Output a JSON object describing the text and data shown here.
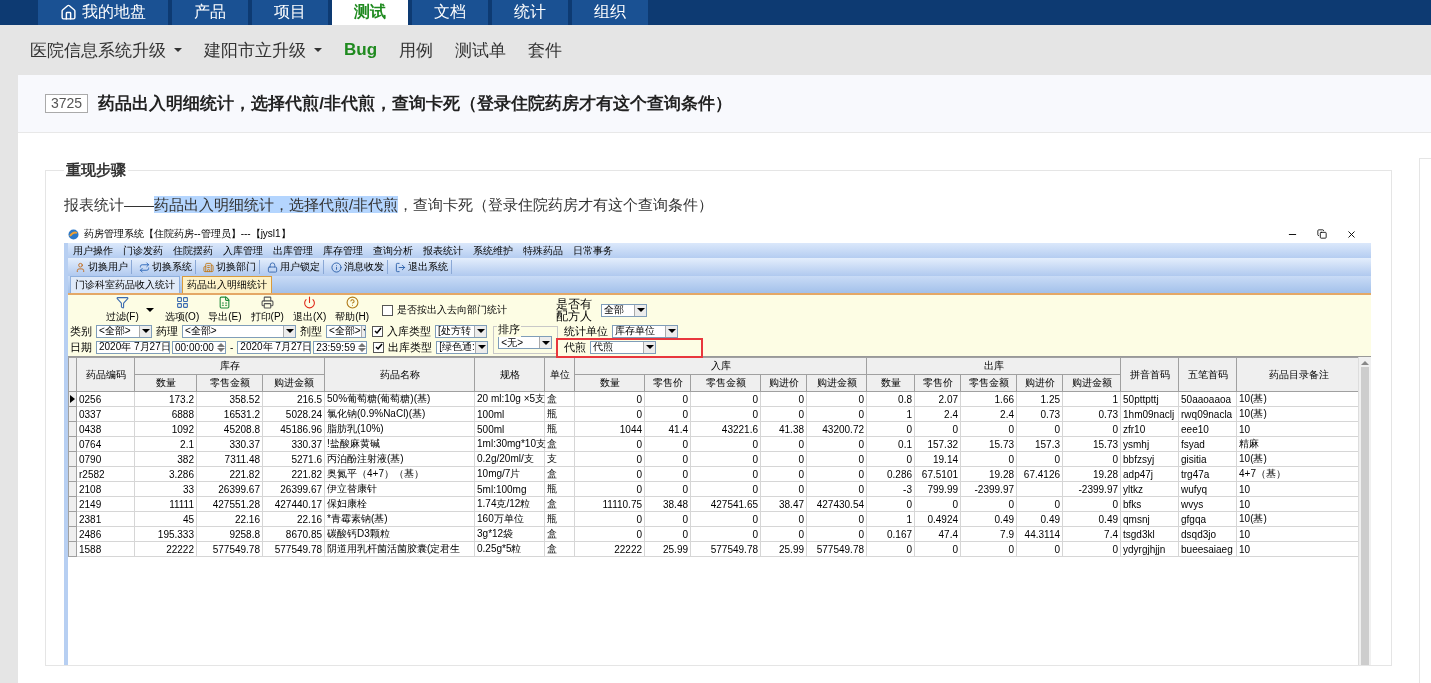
{
  "top_nav": {
    "tabs": [
      {
        "label": "我的地盘",
        "kind": "home",
        "selected": false
      },
      {
        "label": "产品",
        "kind": "plain",
        "selected": false
      },
      {
        "label": "项目",
        "kind": "plain",
        "selected": false
      },
      {
        "label": "测试",
        "kind": "plain",
        "selected": true
      },
      {
        "label": "文档",
        "kind": "plain",
        "selected": false
      },
      {
        "label": "统计",
        "kind": "plain",
        "selected": false
      },
      {
        "label": "组织",
        "kind": "plain",
        "selected": false
      }
    ]
  },
  "sub_nav": {
    "items": [
      {
        "label": "医院信息系统升级",
        "dropdown": true,
        "selected": false
      },
      {
        "label": "建阳市立升级",
        "dropdown": true,
        "selected": false
      },
      {
        "label": "Bug",
        "dropdown": false,
        "selected": true
      },
      {
        "label": "用例",
        "dropdown": false,
        "selected": false
      },
      {
        "label": "测试单",
        "dropdown": false,
        "selected": false
      },
      {
        "label": "套件",
        "dropdown": false,
        "selected": false
      }
    ]
  },
  "bug": {
    "id": "3725",
    "title": "药品出入明细统计，选择代煎/非代煎，查询卡死（登录住院药房才有这个查询条件）"
  },
  "section": {
    "legend": "重现步骤",
    "paragraph": [
      {
        "text": "报表统计——",
        "highlighted": false
      },
      {
        "text": "药品出入明细统计，选择代煎/非代煎",
        "highlighted": true
      },
      {
        "text": "，查询卡死（登录住院药房才有这个查询条件）",
        "highlighted": false
      }
    ]
  },
  "app_window": {
    "title": "药房管理系统【住院药房--管理员】---【jysl1】",
    "menu": [
      "用户操作",
      "门诊发药",
      "住院摆药",
      "入库管理",
      "出库管理",
      "库存管理",
      "查询分析",
      "报表统计",
      "系统维护",
      "特殊药品",
      "日常事务"
    ],
    "toolbar": [
      {
        "label": "切换用户",
        "kind": "user"
      },
      {
        "label": "切换系统",
        "kind": "system"
      },
      {
        "label": "切换部门",
        "kind": "department"
      },
      {
        "label": "用户锁定",
        "kind": "lock"
      },
      {
        "label": "消息收发",
        "kind": "message"
      },
      {
        "label": "退出系统",
        "kind": "exit"
      }
    ],
    "tabs": [
      {
        "label": "门诊科室药品收入统计",
        "selected": false
      },
      {
        "label": "药品出入明细统计",
        "selected": true
      }
    ],
    "filter": {
      "actions": [
        {
          "label": "过滤(F)",
          "kind": "filter",
          "dropdown": true
        },
        {
          "label": "选项(O)",
          "kind": "options",
          "dropdown": false
        },
        {
          "label": "导出(E)",
          "kind": "export",
          "dropdown": false
        },
        {
          "label": "打印(P)",
          "kind": "print",
          "dropdown": false
        },
        {
          "label": "退出(X)",
          "kind": "exit",
          "dropdown": false
        },
        {
          "label": "帮助(H)",
          "kind": "help",
          "dropdown": false
        }
      ],
      "dept_option": {
        "label": "是否按出入去向部门统计",
        "checked": false
      },
      "prescriber": {
        "label": "是否有配方人",
        "value": "全部"
      },
      "category": {
        "label": "类别",
        "value": "<全部>"
      },
      "pharmacology": {
        "label": "药理",
        "value": "<全部>"
      },
      "dosage_form": {
        "label": "剂型",
        "value": "<全部>"
      },
      "date": {
        "label": "日期",
        "from_date": "2020年 7月27日",
        "from_time": "00:00:00",
        "separator": "-",
        "to_date": "2020年 7月27日",
        "to_time": "23:59:59"
      },
      "in_type": {
        "label": "入库类型",
        "checked": true,
        "value": "[处方转"
      },
      "out_type": {
        "label": "出库类型",
        "checked": true,
        "value": "[绿色通:"
      },
      "sort": {
        "label": "排序",
        "value": "<无>"
      },
      "unit": {
        "label": "统计单位",
        "value": "库存单位"
      },
      "decoction": {
        "label": "代煎",
        "value": "代煎"
      }
    },
    "table": {
      "header": [
        {
          "label": "药品编码"
        },
        {
          "label": "库存",
          "sub": [
            "数量",
            "零售金额",
            "购进金额"
          ]
        },
        {
          "label": "药品名称"
        },
        {
          "label": "规格"
        },
        {
          "label": "单位"
        },
        {
          "label": "入库",
          "sub": [
            "数量",
            "零售价",
            "零售金额",
            "购进价",
            "购进金额"
          ]
        },
        {
          "label": "出库",
          "sub": [
            "数量",
            "零售价",
            "零售金额",
            "购进价",
            "购进金额"
          ]
        },
        {
          "label": "拼音首码"
        },
        {
          "label": "五笔首码"
        },
        {
          "label": "药品目录备注"
        }
      ],
      "rows": [
        {
          "selected": true,
          "cells": [
            "0256",
            "173.2",
            "358.52",
            "216.5",
            "50%葡萄糖(葡萄糖)(基)",
            "20 ml:10g ×5支",
            "盒",
            "0",
            "0",
            "0",
            "0",
            "0",
            "0.8",
            "2.07",
            "1.66",
            "1.25",
            "1",
            "50pttpttj",
            "50aaoaaoa",
            "10(基)"
          ]
        },
        {
          "selected": false,
          "cells": [
            "0337",
            "6888",
            "16531.2",
            "5028.24",
            "氯化钠(0.9%NaCl)(基)",
            "100ml",
            "瓶",
            "0",
            "0",
            "0",
            "0",
            "0",
            "1",
            "2.4",
            "2.4",
            "0.73",
            "0.73",
            "1hm09naclj",
            "rwq09nacla",
            "10(基)"
          ]
        },
        {
          "selected": false,
          "cells": [
            "0438",
            "1092",
            "45208.8",
            "45186.96",
            "脂肪乳(10%)",
            "500ml",
            "瓶",
            "1044",
            "41.4",
            "43221.6",
            "41.38",
            "43200.72",
            "0",
            "0",
            "0",
            "0",
            "0",
            "zfr10",
            "eee10",
            "10"
          ]
        },
        {
          "selected": false,
          "cells": [
            "0764",
            "2.1",
            "330.37",
            "330.37",
            "!盐酸麻黄碱",
            "1ml:30mg*10支",
            "盒",
            "0",
            "0",
            "0",
            "0",
            "0",
            "0.1",
            "157.32",
            "15.73",
            "157.3",
            "15.73",
            "ysmhj",
            "fsyad",
            "精麻"
          ]
        },
        {
          "selected": false,
          "cells": [
            "0790",
            "382",
            "7311.48",
            "5271.6",
            "丙泊酚注射液(基)",
            "0.2g/20ml/支",
            "支",
            "0",
            "0",
            "0",
            "0",
            "0",
            "0",
            "19.14",
            "0",
            "0",
            "0",
            "bbfzsyj",
            "gisitia",
            "10(基)"
          ]
        },
        {
          "selected": false,
          "cells": [
            "r2582",
            "3.286",
            "221.82",
            "221.82",
            "奥氮平（4+7）（基）",
            "10mg/7片",
            "盒",
            "0",
            "0",
            "0",
            "0",
            "0",
            "0.286",
            "67.5101",
            "19.28",
            "67.4126",
            "19.28",
            "adp47j",
            "trg47a",
            "4+7（基）"
          ]
        },
        {
          "selected": false,
          "cells": [
            "2108",
            "33",
            "26399.67",
            "26399.67",
            "伊立替康针",
            "5ml:100mg",
            "瓶",
            "0",
            "0",
            "0",
            "0",
            "0",
            "-3",
            "799.99",
            "-2399.97",
            null,
            "-2399.97",
            "yltkz",
            "wufyq",
            "10"
          ]
        },
        {
          "selected": false,
          "cells": [
            "2149",
            "11111",
            "427551.28",
            "427440.17",
            "保妇康栓",
            "1.74克/12粒",
            "盒",
            "11110.75",
            "38.48",
            "427541.65",
            "38.47",
            "427430.54",
            "0",
            "0",
            "0",
            "0",
            "0",
            "bfks",
            "wvys",
            "10"
          ]
        },
        {
          "selected": false,
          "cells": [
            "2381",
            "45",
            "22.16",
            "22.16",
            "*青霉素钠(基)",
            "160万单位",
            "瓶",
            "0",
            "0",
            "0",
            "0",
            "0",
            "1",
            "0.4924",
            "0.49",
            "0.49",
            "0.49",
            "qmsnj",
            "gfgqa",
            "10(基)"
          ]
        },
        {
          "selected": false,
          "cells": [
            "2486",
            "195.333",
            "9258.8",
            "8670.85",
            "碳酸钙D3颗粒",
            "3g*12袋",
            "盒",
            "0",
            "0",
            "0",
            "0",
            "0",
            "0.167",
            "47.4",
            "7.9",
            "44.3114",
            "7.4",
            "tsgd3kl",
            "dsqd3jo",
            "10"
          ]
        },
        {
          "selected": false,
          "cells": [
            "1588",
            "22222",
            "577549.78",
            "577549.78",
            "阴道用乳杆菌活菌胶囊(定君生",
            "0.25g*5粒",
            "盒",
            "22222",
            "25.99",
            "577549.78",
            "25.99",
            "577549.78",
            "0",
            "0",
            "0",
            "0",
            "0",
            "ydyrgjhjjn",
            "bueesaiaeg",
            "10"
          ]
        }
      ]
    }
  }
}
